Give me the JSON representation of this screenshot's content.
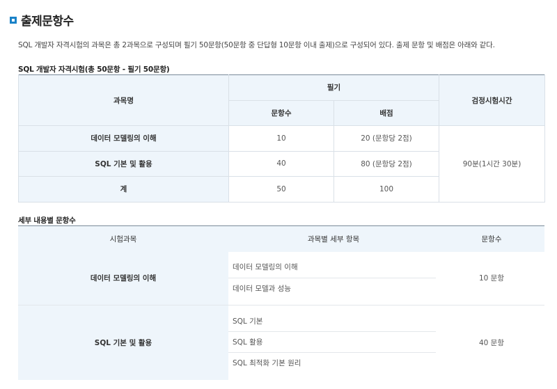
{
  "page": {
    "title": "출제문항수",
    "intro": "SQL 개발자 자격시험의 과목은 총 2과목으로 구성되며 필기 50문항(50문항 중 단답형 10문항 이내 출제)으로 구성되어 있다. 출제 문항 및 배점은 아래와 같다."
  },
  "table1": {
    "caption": "SQL 개발자 자격시험(총 50문항 - 필기 50문항)",
    "headers": {
      "subject": "과목명",
      "written": "필기",
      "questions": "문항수",
      "points": "배점",
      "time": "검정시험시간"
    },
    "rows": [
      {
        "subject": "데이터 모델링의 이해",
        "questions": "10",
        "points": "20 (문항당 2점)"
      },
      {
        "subject": "SQL 기본 및 활용",
        "questions": "40",
        "points": "80 (문항당 2점)"
      },
      {
        "subject": "계",
        "questions": "50",
        "points": "100"
      }
    ],
    "time": "90분(1시간 30분)"
  },
  "table2": {
    "caption": "세부 내용별 문항수",
    "headers": {
      "subject": "시험과목",
      "details": "과목별 세부 항목",
      "count": "문항수"
    },
    "groups": [
      {
        "subject": "데이터 모델링의 이해",
        "items": [
          "데이터 모델링의 이해",
          "데이터 모델과 성능"
        ],
        "count": "10 문항"
      },
      {
        "subject": "SQL 기본 및 활용",
        "items": [
          "SQL 기본",
          "SQL 활용",
          "SQL 최적화 기본 원리"
        ],
        "count": "40 문항"
      }
    ]
  }
}
